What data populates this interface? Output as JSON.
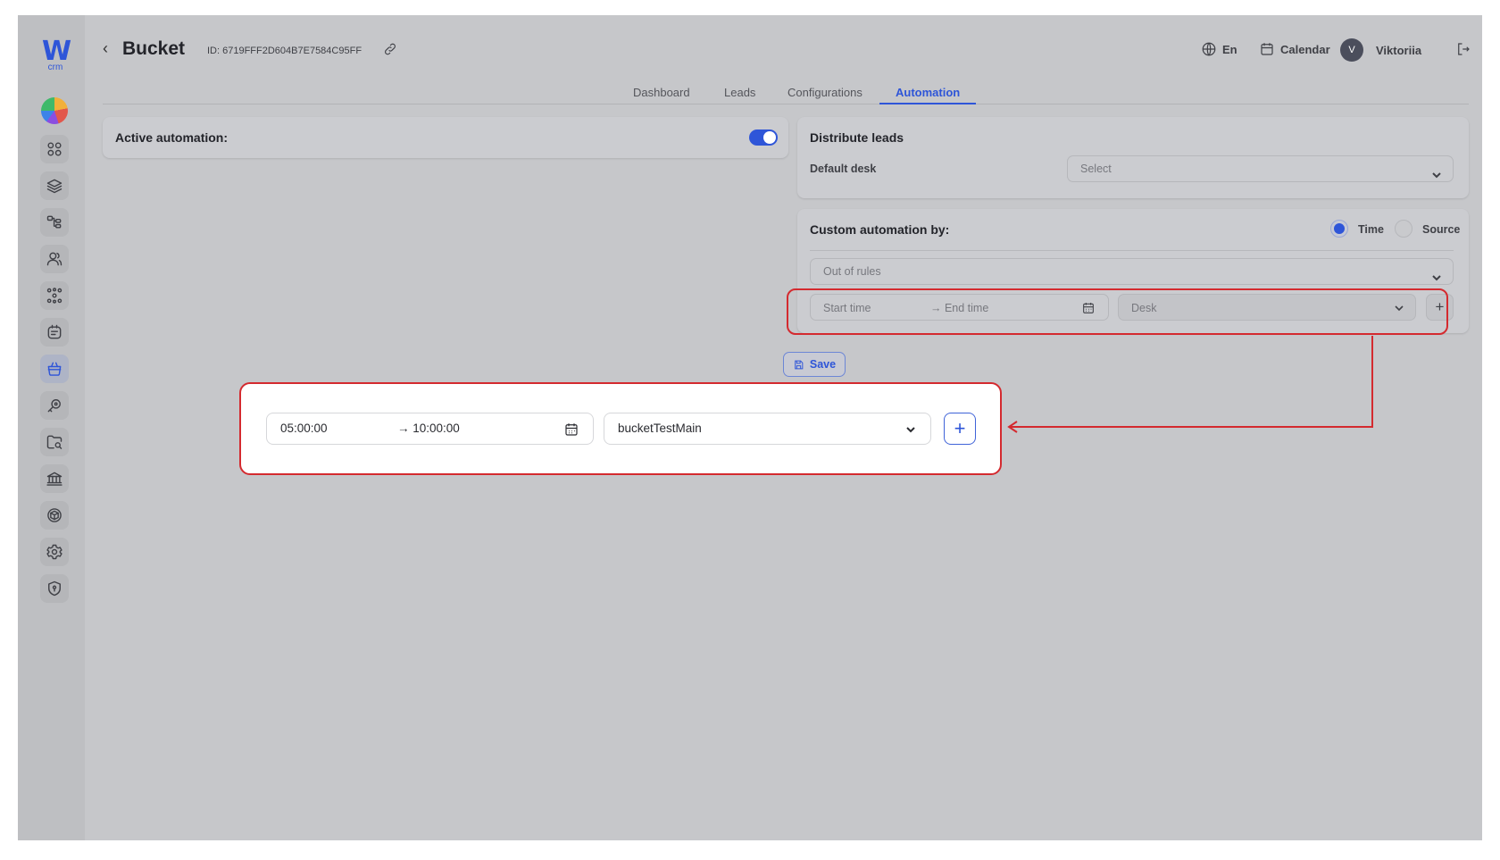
{
  "brand": {
    "logo_letter": "W",
    "logo_sub": "crm"
  },
  "sidebar": {
    "items": [
      {
        "name": "dashboard-icon",
        "active": false
      },
      {
        "name": "layers-icon",
        "active": false
      },
      {
        "name": "hierarchy-icon",
        "active": false
      },
      {
        "name": "users-icon",
        "active": false
      },
      {
        "name": "network-icon",
        "active": false
      },
      {
        "name": "ticket-icon",
        "active": false
      },
      {
        "name": "basket-icon",
        "active": true
      },
      {
        "name": "key-icon",
        "active": false
      },
      {
        "name": "folder-search-icon",
        "active": false
      },
      {
        "name": "bank-icon",
        "active": false
      },
      {
        "name": "box-icon",
        "active": false
      },
      {
        "name": "settings-icon",
        "active": false
      },
      {
        "name": "shield-icon",
        "active": false
      }
    ]
  },
  "header": {
    "back_icon": "chevron-left-icon",
    "title": "Bucket",
    "bucket_id": "ID: 6719FFF2D604B7E7584C95FF",
    "language": "En",
    "calendar_label": "Calendar",
    "avatar_initial": "V",
    "user_name": "Viktoriia"
  },
  "tabs": [
    {
      "label": "Dashboard",
      "active": false
    },
    {
      "label": "Leads",
      "active": false
    },
    {
      "label": "Configurations",
      "active": false
    },
    {
      "label": "Automation",
      "active": true
    }
  ],
  "active_automation": {
    "label": "Active automation:",
    "enabled": true
  },
  "distribute_leads": {
    "title": "Distribute leads",
    "default_desk_label": "Default desk",
    "default_desk_placeholder": "Select"
  },
  "custom_automation": {
    "title": "Custom automation by:",
    "options": [
      {
        "label": "Time",
        "selected": true
      },
      {
        "label": "Source",
        "selected": false
      }
    ],
    "out_of_rules_placeholder": "Out of rules",
    "start_time_placeholder": "Start time",
    "end_time_placeholder": "→ End time",
    "desk_placeholder": "Desk",
    "add_label": "+"
  },
  "save_label": "Save",
  "zoom_example": {
    "start_time": "05:00:00",
    "end_time": "→ 10:00:00",
    "desk": "bucketTestMain",
    "add_label": "+"
  },
  "colors": {
    "accent": "#2e55d8",
    "highlight": "#d42a2f",
    "background": "#c6c7ca"
  }
}
